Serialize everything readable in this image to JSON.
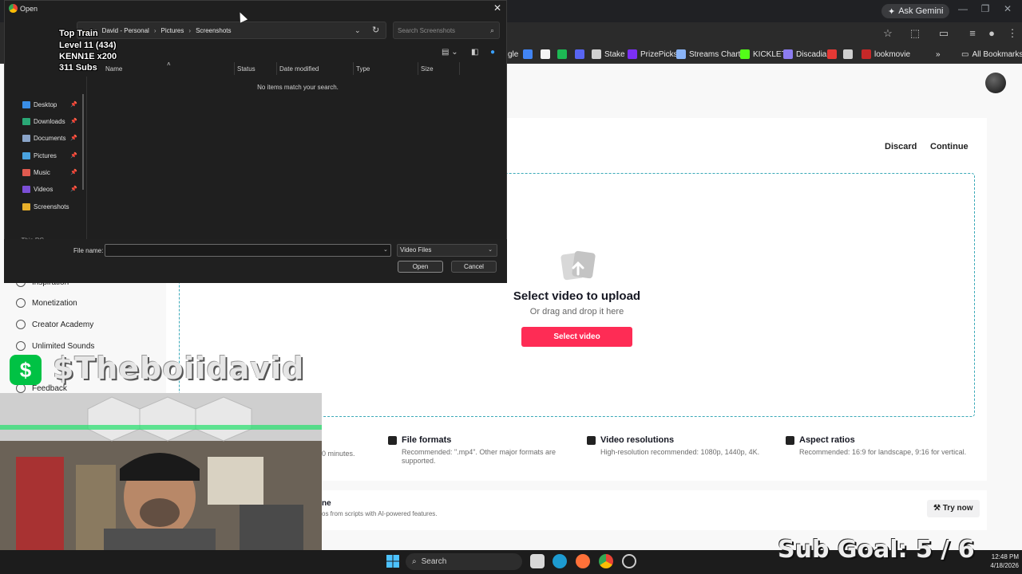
{
  "browser": {
    "ask_gemini": "Ask Gemini",
    "bookmarks": [
      {
        "label": "gle",
        "color": "#8ab4f8"
      },
      {
        "label": "",
        "color": "#4285f4"
      },
      {
        "label": "",
        "color": "#f5f5f5"
      },
      {
        "label": "",
        "color": "#1db954"
      },
      {
        "label": "",
        "color": "#5865f2"
      },
      {
        "label": "Stake",
        "color": "#d0d0d0"
      },
      {
        "label": "PrizePicks",
        "color": "#7b2ff7"
      },
      {
        "label": "Streams Charts",
        "color": "#8ab4f8"
      },
      {
        "label": "KICKLET",
        "color": "#53fc18"
      },
      {
        "label": "Discadia",
        "color": "#8c7cf0"
      },
      {
        "label": "",
        "color": "#e53935"
      },
      {
        "label": "",
        "color": "#d0d0d0"
      },
      {
        "label": "lookmovie",
        "color": "#c62828"
      }
    ],
    "all_bookmarks": "All Bookmarks"
  },
  "dialog": {
    "title": "Open",
    "path": [
      "David - Personal",
      "Pictures",
      "Screenshots"
    ],
    "search_placeholder": "Search Screenshots",
    "columns": [
      "Name",
      "Status",
      "Date modified",
      "Type",
      "Size"
    ],
    "empty_message": "No items match your search.",
    "nav_items": [
      {
        "label": "Desktop",
        "color": "#3a8ee6",
        "pinned": true
      },
      {
        "label": "Downloads",
        "color": "#2aa876",
        "pinned": true
      },
      {
        "label": "Documents",
        "color": "#8aa4c8",
        "pinned": true
      },
      {
        "label": "Pictures",
        "color": "#4aa3df",
        "pinned": true
      },
      {
        "label": "Music",
        "color": "#e05a4f",
        "pinned": true
      },
      {
        "label": "Videos",
        "color": "#7b4fd6",
        "pinned": true
      },
      {
        "label": "Screenshots",
        "color": "#e8b02a",
        "pinned": false
      }
    ],
    "this_pc": "This PC",
    "file_name_label": "File name:",
    "file_name_value": "",
    "file_type": "Video Files",
    "open_label": "Open",
    "cancel_label": "Cancel"
  },
  "upload": {
    "discard": "Discard",
    "continue": "Continue",
    "title": "Select video to upload",
    "subtitle": "Or drag and drop it here",
    "button": "Select video",
    "info": [
      {
        "title": "File formats",
        "desc": "Recommended: \".mp4\". Other major formats are supported."
      },
      {
        "title": "Video resolutions",
        "desc": "High-resolution recommended: 1080p, 1440p, 4K."
      },
      {
        "title": "Aspect ratios",
        "desc": "Recommended: 16:9 for landscape, 9:16 for vertical."
      }
    ],
    "info_cut": "0 minutes.",
    "promo_title": "ne",
    "promo_desc": "os from scripts with AI-powered features.",
    "try_now": "Try now"
  },
  "sidebar": {
    "items": [
      "Inspiration",
      "Monetization",
      "Creator Academy",
      "Unlimited Sounds",
      "Feedback"
    ]
  },
  "overlay": {
    "train_title": "Top Train",
    "train_level": "Level 11  (434)",
    "train_user": "KENN1E x200",
    "train_subs": "311 Subs",
    "cashtag": "$Theboiidavid",
    "sub_goal": "Sub Goal:  5 / 6"
  },
  "taskbar": {
    "search": "Search",
    "time": "12:48 PM",
    "date": "4/18/2026"
  }
}
